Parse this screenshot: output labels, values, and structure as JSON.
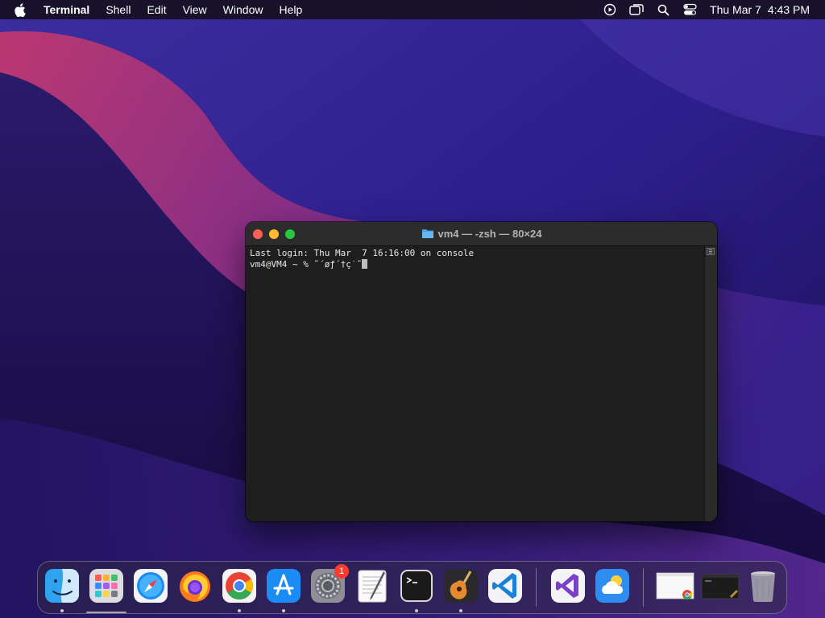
{
  "menubar": {
    "app_name": "Terminal",
    "menus": [
      "Shell",
      "Edit",
      "View",
      "Window",
      "Help"
    ],
    "status_icons": [
      "screen-recording-icon",
      "screen-mirroring-icon",
      "spotlight-search-icon",
      "control-center-icon"
    ],
    "date": "Thu Mar 7",
    "time": "4:43 PM"
  },
  "terminal": {
    "title": "vm4 — -zsh — 80×24",
    "lines": [
      "Last login: Thu Mar  7 16:16:00 on console",
      "vm4@VM4 ~ % ˜´øƒ´†ç˙˜"
    ],
    "colors": {
      "background": "#1e1e1e",
      "text": "#e8e8e8"
    }
  },
  "dock": {
    "apps": [
      {
        "name": "Finder",
        "icon": "finder-icon",
        "running": true
      },
      {
        "name": "Launchpad",
        "icon": "launchpad-icon",
        "running": false
      },
      {
        "name": "Safari",
        "icon": "safari-icon",
        "running": false
      },
      {
        "name": "Firefox",
        "icon": "firefox-icon",
        "running": false
      },
      {
        "name": "Google Chrome",
        "icon": "chrome-icon",
        "running": true
      },
      {
        "name": "App Store",
        "icon": "app-store-icon",
        "running": true
      },
      {
        "name": "System Settings",
        "icon": "system-settings-icon",
        "running": false,
        "badge": "1"
      },
      {
        "name": "TextEdit",
        "icon": "textedit-icon",
        "running": false
      },
      {
        "name": "Terminal",
        "icon": "terminal-icon",
        "running": true
      },
      {
        "name": "GarageBand",
        "icon": "garageband-icon",
        "running": true
      },
      {
        "name": "Visual Studio Code",
        "icon": "vscode-icon",
        "running": false
      },
      {
        "name": "Visual Studio",
        "icon": "visual-studio-icon",
        "running": false
      },
      {
        "name": "Weather",
        "icon": "weather-icon",
        "running": false
      }
    ],
    "minimized": [
      "chrome-window-thumbnail",
      "terminal-window-thumbnail"
    ],
    "trash": "trash-icon"
  }
}
